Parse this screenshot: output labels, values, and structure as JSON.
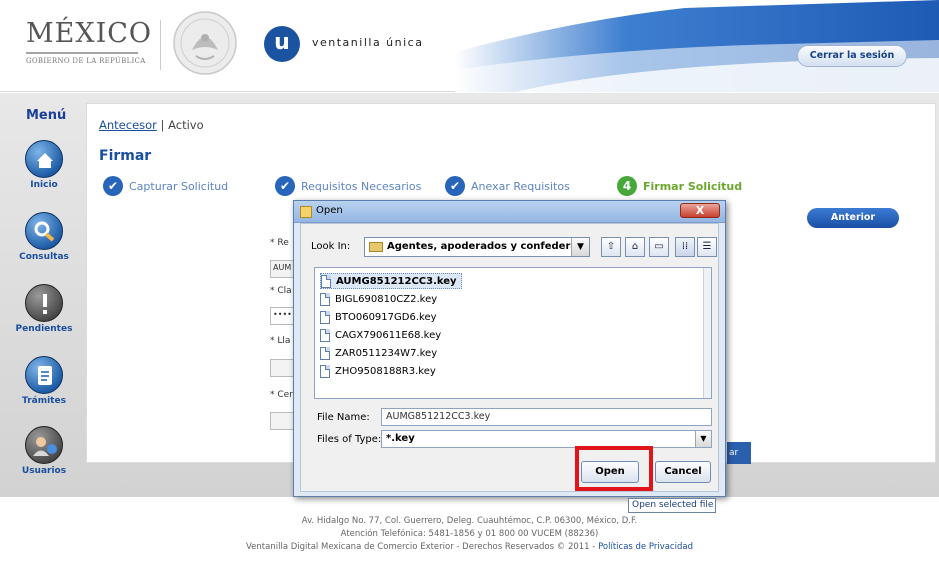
{
  "header": {
    "country": "MÉXICO",
    "government": "GOBIERNO DE LA REPÚBLICA",
    "brand_letter": "u",
    "brand_name": "ventanilla única",
    "logout_label": "Cerrar la sesión"
  },
  "sidebar": {
    "title": "Menú",
    "items": [
      {
        "label": "Inicio",
        "icon": "home-icon"
      },
      {
        "label": "Consultas",
        "icon": "magnifier-icon"
      },
      {
        "label": "Pendientes",
        "icon": "alert-icon"
      },
      {
        "label": "Trámites",
        "icon": "document-icon"
      },
      {
        "label": "Usuarios",
        "icon": "users-icon"
      }
    ]
  },
  "content": {
    "breadcrumb_link": "Antecesor",
    "breadcrumb_sep": " | ",
    "breadcrumb_current": "Activo",
    "title": "Firmar",
    "steps": [
      {
        "label": "Capturar Solicitud",
        "mark": "✔"
      },
      {
        "label": "Requisitos Necesarios",
        "mark": "✔"
      },
      {
        "label": "Anexar Requisitos",
        "mark": "✔"
      },
      {
        "label": "Firmar Solicitud",
        "mark": "4"
      }
    ],
    "prev_button": "Anterior",
    "fields": [
      {
        "label": "* Re",
        "value": "AUM"
      },
      {
        "label": "* Cla",
        "value": "••••"
      },
      {
        "label": "* Lla",
        "value": ""
      },
      {
        "label": "* Cer",
        "value": ""
      }
    ],
    "hidden_button_fragment": "ar"
  },
  "footer": {
    "line1": "Av. Hidalgo No. 77, Col. Guerrero, Deleg. Cuauhtémoc, C.P. 06300, México, D.F.",
    "line2": "Atención Telefónica: 5481-1856 y 01 800 00 VUCEM (88236)",
    "line3": "Ventanilla Digital Mexicana de Comercio Exterior - Derechos Reservados © 2011 - ",
    "privacy_link": "Políticas de Privacidad"
  },
  "dialog": {
    "title": "Open",
    "close": "X",
    "look_in_label": "Look In:",
    "look_in_value": "Agentes, apoderados y confederaciones",
    "toolbar": [
      "up-folder-icon",
      "home-folder-icon",
      "new-folder-icon",
      "list-view-icon",
      "details-view-icon"
    ],
    "files": [
      "AUMG851212CC3.key",
      "BIGL690810CZ2.key",
      "BTO060917GD6.key",
      "CAGX790611E68.key",
      "ZAR0511234W7.key",
      "ZHO9508188R3.key"
    ],
    "selected_index": 0,
    "file_name_label": "File Name:",
    "file_name_value": "AUMG851212CC3.key",
    "files_of_type_label": "Files of Type:",
    "files_of_type_value": "*.key",
    "open_button": "Open",
    "cancel_button": "Cancel",
    "tooltip": "Open selected file"
  },
  "colors": {
    "brand_blue": "#1a4fa0",
    "highlight_red": "#e0141b",
    "active_step_green": "#47a83a"
  }
}
